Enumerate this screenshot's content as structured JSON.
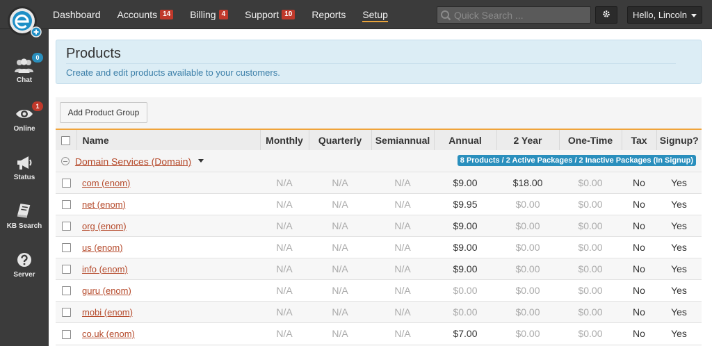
{
  "nav": {
    "items": [
      {
        "label": "Dashboard",
        "badge": null
      },
      {
        "label": "Accounts",
        "badge": "14"
      },
      {
        "label": "Billing",
        "badge": "4"
      },
      {
        "label": "Support",
        "badge": "10"
      },
      {
        "label": "Reports",
        "badge": null
      },
      {
        "label": "Setup",
        "badge": null,
        "active": true
      }
    ],
    "search_placeholder": "Quick Search ...",
    "user_label": "Hello, Lincoln"
  },
  "sidebar": {
    "items": [
      {
        "label": "Chat",
        "icon": "users-icon",
        "badge": "0",
        "badge_color": "#2a8fbd"
      },
      {
        "label": "Online",
        "icon": "eye-icon",
        "badge": "1",
        "badge_color": "#c0392b"
      },
      {
        "label": "Status",
        "icon": "megaphone-icon",
        "badge": null
      },
      {
        "label": "KB Search",
        "icon": "book-icon",
        "badge": null
      },
      {
        "label": "Server",
        "icon": "question-icon",
        "badge": null
      }
    ]
  },
  "page": {
    "title": "Products",
    "subtitle": "Create and edit products available to your customers.",
    "add_group_label": "Add Product Group"
  },
  "table": {
    "headers": [
      "Name",
      "Monthly",
      "Quarterly",
      "Semiannual",
      "Annual",
      "2 Year",
      "One-Time",
      "Tax",
      "Signup?"
    ],
    "group": {
      "name": "Domain Services (Domain)",
      "summary": "8 Products / 2 Active Packages / 2 Inactive Packages (In Signup)"
    },
    "rows": [
      {
        "name": "com (enom)",
        "monthly": "N/A",
        "quarterly": "N/A",
        "semiannual": "N/A",
        "annual": "$9.00",
        "two_year": "$18.00",
        "one_time": "$0.00",
        "tax": "No",
        "signup": "Yes"
      },
      {
        "name": "net (enom)",
        "monthly": "N/A",
        "quarterly": "N/A",
        "semiannual": "N/A",
        "annual": "$9.95",
        "two_year": "$0.00",
        "one_time": "$0.00",
        "tax": "No",
        "signup": "Yes"
      },
      {
        "name": "org (enom)",
        "monthly": "N/A",
        "quarterly": "N/A",
        "semiannual": "N/A",
        "annual": "$9.00",
        "two_year": "$0.00",
        "one_time": "$0.00",
        "tax": "No",
        "signup": "Yes"
      },
      {
        "name": "us (enom)",
        "monthly": "N/A",
        "quarterly": "N/A",
        "semiannual": "N/A",
        "annual": "$9.00",
        "two_year": "$0.00",
        "one_time": "$0.00",
        "tax": "No",
        "signup": "Yes"
      },
      {
        "name": "info (enom)",
        "monthly": "N/A",
        "quarterly": "N/A",
        "semiannual": "N/A",
        "annual": "$9.00",
        "two_year": "$0.00",
        "one_time": "$0.00",
        "tax": "No",
        "signup": "Yes"
      },
      {
        "name": "guru (enom)",
        "monthly": "N/A",
        "quarterly": "N/A",
        "semiannual": "N/A",
        "annual": "$0.00",
        "two_year": "$0.00",
        "one_time": "$0.00",
        "tax": "No",
        "signup": "Yes"
      },
      {
        "name": "mobi (enom)",
        "monthly": "N/A",
        "quarterly": "N/A",
        "semiannual": "N/A",
        "annual": "$0.00",
        "two_year": "$0.00",
        "one_time": "$0.00",
        "tax": "No",
        "signup": "Yes"
      },
      {
        "name": "co.uk (enom)",
        "monthly": "N/A",
        "quarterly": "N/A",
        "semiannual": "N/A",
        "annual": "$7.00",
        "two_year": "$0.00",
        "one_time": "$0.00",
        "tax": "No",
        "signup": "Yes"
      }
    ]
  },
  "colors": {
    "accent": "#f0a43a",
    "link": "#b5492a",
    "info_badge": "#2a8fbd",
    "alert_badge": "#c0392b"
  }
}
